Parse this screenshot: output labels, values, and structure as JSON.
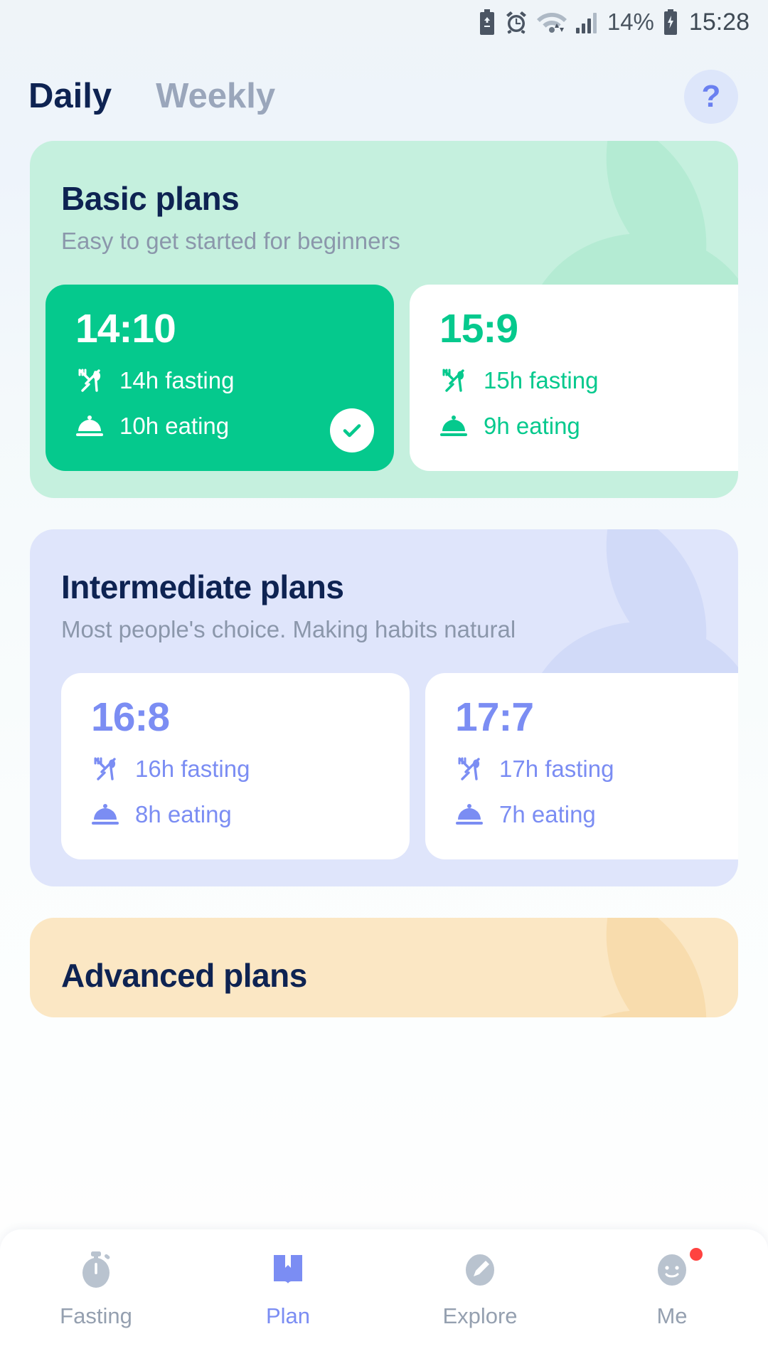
{
  "statusbar": {
    "icons": [
      "battery-saver-icon",
      "alarm-icon",
      "wifi-icon",
      "signal-icon",
      "battery-charging-icon"
    ],
    "battery_percent": "14%",
    "clock": "15:28"
  },
  "header": {
    "tabs": [
      {
        "label": "Daily",
        "active": true
      },
      {
        "label": "Weekly",
        "active": false
      }
    ],
    "help_label": "?"
  },
  "colors": {
    "accent_green": "#05c98d",
    "accent_blue": "#7b8df3",
    "basic_bg": "#c5f0de",
    "intermediate_bg": "#dfe5fb",
    "advanced_bg": "#fbe7c4",
    "title_navy": "#0e2352",
    "muted": "#8b97ab",
    "badge_red": "#ff4340"
  },
  "sections": [
    {
      "title": "Basic plans",
      "subtitle": "Easy to get started for beginners",
      "theme": "basic",
      "cards": [
        {
          "peek": true
        },
        {
          "ratio": "14:10",
          "fasting": "14h fasting",
          "eating": "10h eating",
          "selected": true
        },
        {
          "ratio": "15:9",
          "fasting": "15h fasting",
          "eating": "9h eating",
          "selected": false
        }
      ]
    },
    {
      "title": "Intermediate plans",
      "subtitle": "Most people's choice. Making habits natural",
      "theme": "intermediate",
      "cards": [
        {
          "ratio": "16:8",
          "fasting": "16h fasting",
          "eating": "8h eating",
          "selected": false
        },
        {
          "ratio": "17:7",
          "fasting": "17h fasting",
          "eating": "7h eating",
          "selected": false
        }
      ]
    },
    {
      "title": "Advanced plans",
      "subtitle": "",
      "theme": "advanced",
      "cards": []
    }
  ],
  "bottomnav": {
    "items": [
      {
        "label": "Fasting",
        "icon": "stopwatch-icon",
        "active": false,
        "badge": false
      },
      {
        "label": "Plan",
        "icon": "book-icon",
        "active": true,
        "badge": false
      },
      {
        "label": "Explore",
        "icon": "pencil-circle-icon",
        "active": false,
        "badge": false
      },
      {
        "label": "Me",
        "icon": "person-circle-icon",
        "active": false,
        "badge": true
      }
    ]
  }
}
